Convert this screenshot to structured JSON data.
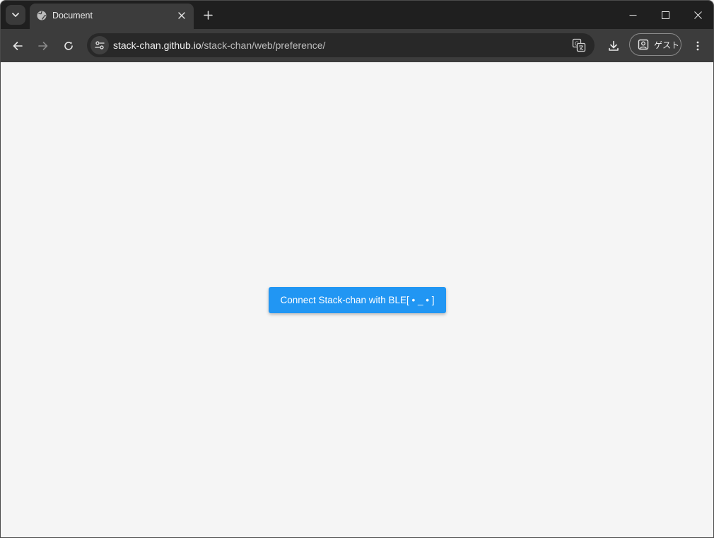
{
  "tab": {
    "title": "Document",
    "favicon": "globe-icon"
  },
  "address_bar": {
    "url_host": "stack-chan.github.io",
    "url_path": "/stack-chan/web/preference/"
  },
  "profile": {
    "label": "ゲスト"
  },
  "page": {
    "connect_button_label": "Connect Stack-chan with BLE[ • _ • ]"
  },
  "colors": {
    "tabstrip_bg": "#1f1f1f",
    "toolbar_bg": "#3c3c3c",
    "omnibox_bg": "#282828",
    "page_bg": "#f5f5f5",
    "button_bg": "#2196f3",
    "button_text": "#ffffff"
  }
}
